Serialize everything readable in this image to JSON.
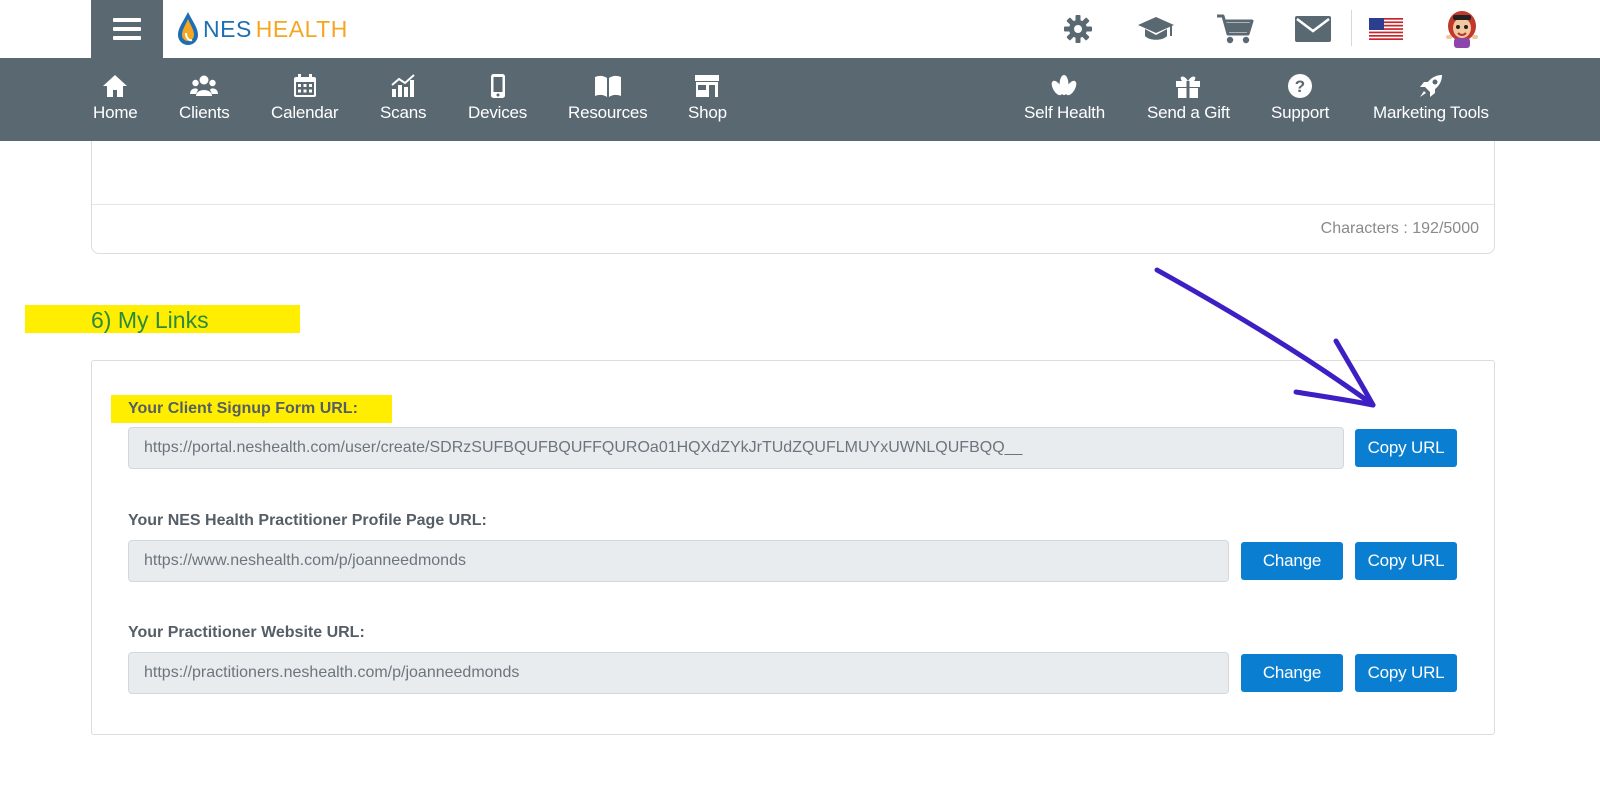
{
  "header": {
    "logo_part1": "NES",
    "logo_part2": "HEALTH",
    "icons": [
      "gear-icon",
      "graduation-cap-icon",
      "cart-icon",
      "mail-icon",
      "us-flag-icon",
      "avatar"
    ]
  },
  "nav": {
    "left": [
      {
        "label": "Home",
        "icon": "home-icon"
      },
      {
        "label": "Clients",
        "icon": "clients-icon"
      },
      {
        "label": "Calendar",
        "icon": "calendar-icon"
      },
      {
        "label": "Scans",
        "icon": "scans-icon"
      },
      {
        "label": "Devices",
        "icon": "device-icon"
      },
      {
        "label": "Resources",
        "icon": "book-icon"
      },
      {
        "label": "Shop",
        "icon": "shop-icon"
      }
    ],
    "right": [
      {
        "label": "Self Health",
        "icon": "lotus-icon"
      },
      {
        "label": "Send a Gift",
        "icon": "gift-icon"
      },
      {
        "label": "Support",
        "icon": "help-icon"
      },
      {
        "label": "Marketing Tools",
        "icon": "rocket-icon"
      }
    ]
  },
  "top_panel": {
    "char_count": "Characters : 192/5000"
  },
  "links": {
    "section_title": "6) My Links",
    "signup_label": "Your Client Signup Form URL:",
    "signup_url": "https://portal.neshealth.com/user/create/SDRzSUFBQUFBQUFFQUROa01HQXdZYkJrTUdZQUFLMUYxUWNLQUFBQQ__",
    "profile_label": "Your NES Health Practitioner Profile Page URL:",
    "profile_url": "https://www.neshealth.com/p/joanneedmonds",
    "website_label": "Your Practitioner Website URL:",
    "website_url": "https://practitioners.neshealth.com/p/joanneedmonds",
    "copy_label": "Copy URL",
    "change_label": "Change"
  },
  "colors": {
    "nav_bg": "#5a6872",
    "button_blue": "#0a7fd1",
    "highlight_yellow": "#ffee00",
    "section_green": "#2b8a3e",
    "annotation_arrow": "#3d1fc4"
  }
}
